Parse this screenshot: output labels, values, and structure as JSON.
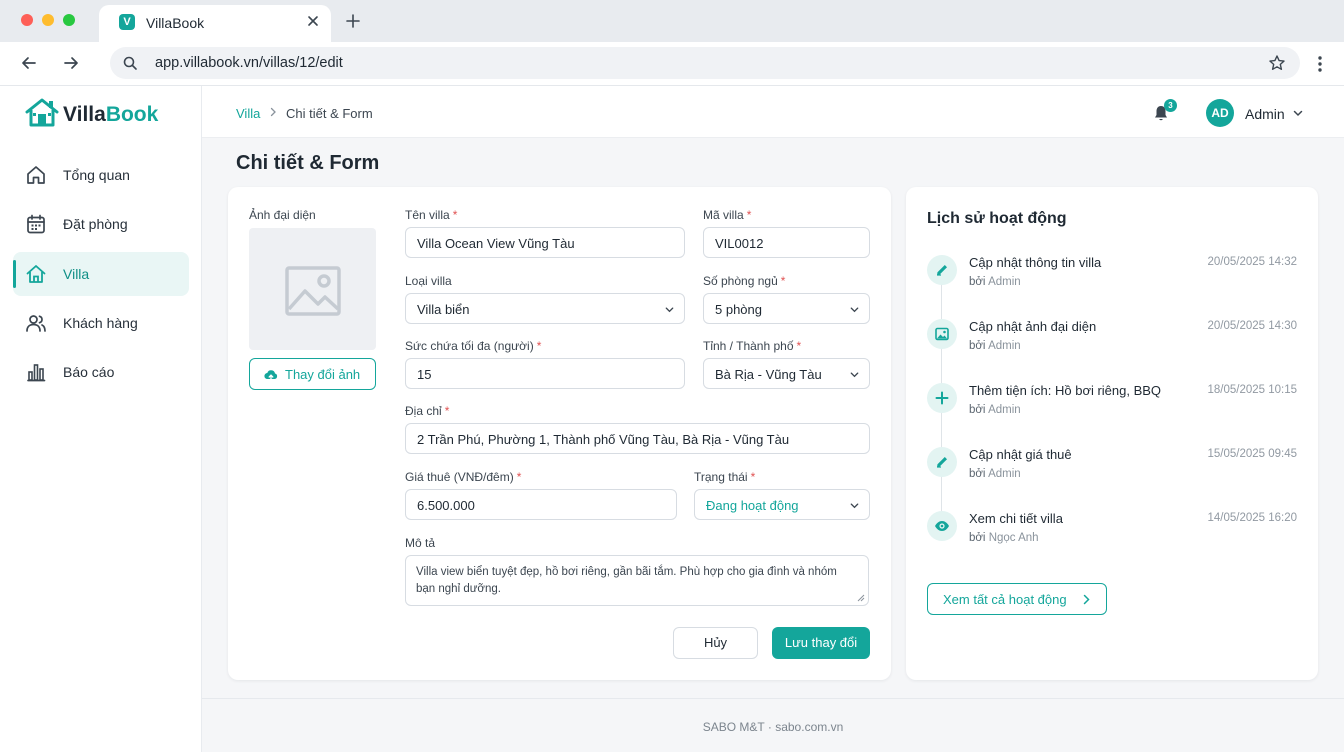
{
  "browser": {
    "tab_title": "VillaBook",
    "favicon_letter": "V",
    "url": "app.villabook.vn/villas/12/edit"
  },
  "sidebar": {
    "brand_part1": "Villa",
    "brand_part2": "Book",
    "items": [
      {
        "label": "Tổng quan",
        "icon": "home-icon",
        "active": false
      },
      {
        "label": "Đặt phòng",
        "icon": "calendar-icon",
        "active": false
      },
      {
        "label": "Villa",
        "icon": "villa-icon",
        "active": true
      },
      {
        "label": "Khách hàng",
        "icon": "users-icon",
        "active": false
      },
      {
        "label": "Báo cáo",
        "icon": "bar-chart-icon",
        "active": false
      }
    ]
  },
  "header": {
    "breadcrumb": [
      "Villa",
      "Chi tiết & Form"
    ],
    "notification_count": "3",
    "avatar_initials": "AD",
    "user_name": "Admin"
  },
  "page": {
    "title": "Chi tiết & Form"
  },
  "form": {
    "image_label": "Ảnh đại diện",
    "change_image_button": "Thay đổi ảnh",
    "name_label": "Tên villa",
    "name_value": "Villa Ocean View Vũng Tàu",
    "code_label": "Mã villa",
    "code_value": "VIL0012",
    "type_label": "Loại villa",
    "type_value": "Villa biển",
    "bedrooms_label": "Số phòng ngủ",
    "bedrooms_value": "5 phòng",
    "capacity_label": "Sức chứa tối đa (người)",
    "capacity_value": "15",
    "province_label": "Tỉnh / Thành phố",
    "province_value": "Bà Rịa - Vũng Tàu",
    "address_label": "Địa chỉ",
    "address_value": "2 Trần Phú, Phường 1, Thành phố Vũng Tàu, Bà Rịa - Vũng Tàu",
    "price_label": "Giá thuê (VNĐ/đêm)",
    "price_value": "6.500.000",
    "status_label": "Trạng thái",
    "status_value": "Đang hoạt động",
    "description_label": "Mô tả",
    "description_value": "Villa view biển tuyệt đẹp, hồ bơi riêng, gần bãi tắm. Phù hợp cho gia đình và nhóm bạn nghỉ dưỡng.",
    "cancel_button": "Hủy",
    "save_button": "Lưu thay đổi",
    "required_mark": "*"
  },
  "history": {
    "title": "Lịch sử hoạt động",
    "by_prefix": "bởi",
    "items": [
      {
        "action": "Cập nhật thông tin villa",
        "by": "Admin",
        "time": "20/05/2025 14:32",
        "icon": "pencil-icon"
      },
      {
        "action": "Cập nhật ảnh đại diện",
        "by": "Admin",
        "time": "20/05/2025 14:30",
        "icon": "image-icon"
      },
      {
        "action": "Thêm tiện ích: Hồ bơi riêng, BBQ",
        "by": "Admin",
        "time": "18/05/2025 10:15",
        "icon": "plus-icon"
      },
      {
        "action": "Cập nhật giá thuê",
        "by": "Admin",
        "time": "15/05/2025 09:45",
        "icon": "pencil-icon"
      },
      {
        "action": "Xem chi tiết villa",
        "by": "Ngọc Anh",
        "time": "14/05/2025 16:20",
        "icon": "eye-icon"
      }
    ],
    "view_all_button": "Xem tất cả hoạt động"
  },
  "footer": {
    "text": "SABO M&T · sabo.com.vn"
  },
  "colors": {
    "accent": "#14a69b",
    "required": "#e05252",
    "active_bg": "#e9f6f5"
  }
}
